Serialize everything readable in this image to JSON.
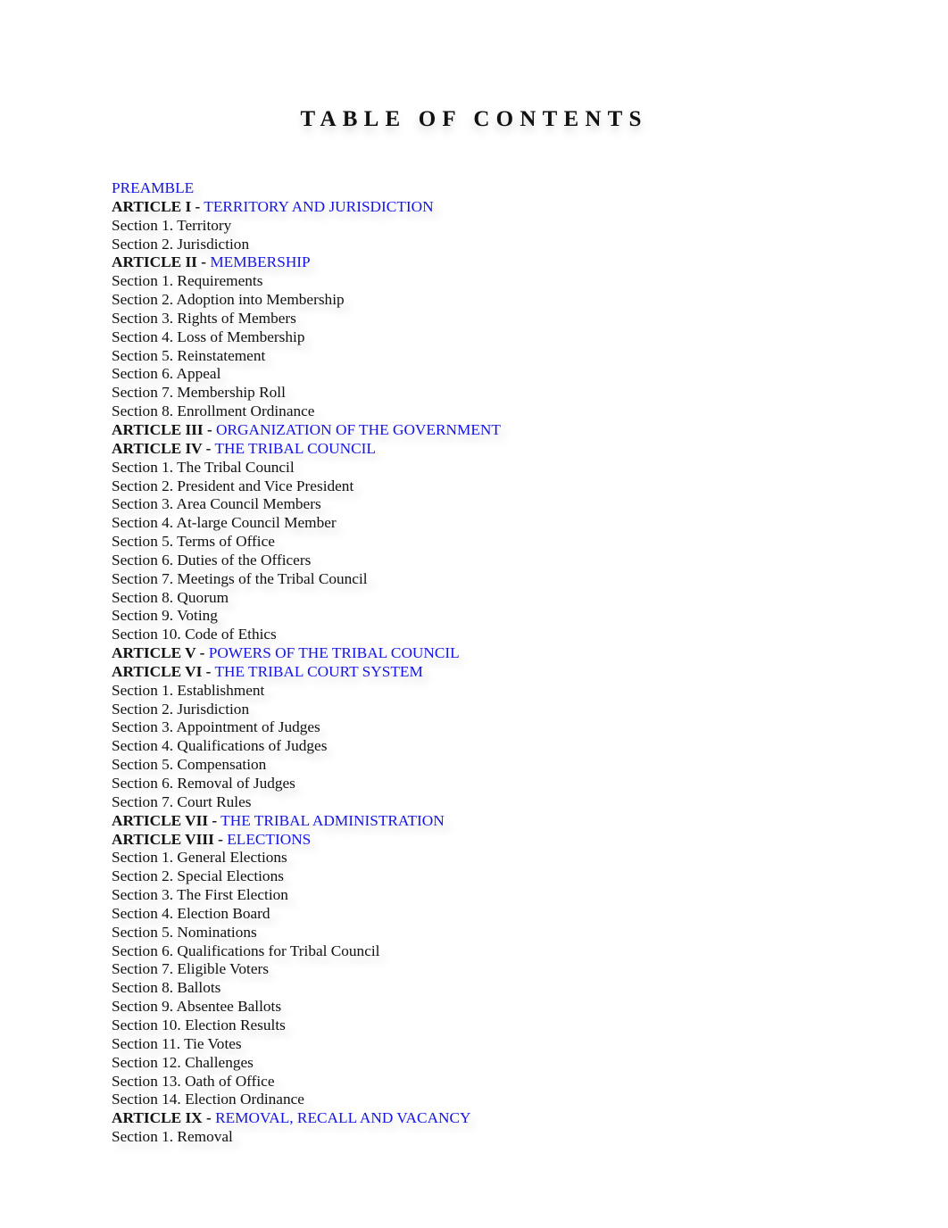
{
  "page": {
    "title": "TABLE OF CONTENTS",
    "link_color": "#1414e6"
  },
  "toc": [
    {
      "type": "link",
      "text": "PREAMBLE"
    },
    {
      "type": "article",
      "label": "ARTICLE I -",
      "title": "TERRITORY AND JURISDICTION"
    },
    {
      "type": "section",
      "text": "Section 1. Territory"
    },
    {
      "type": "section",
      "text": "Section 2. Jurisdiction"
    },
    {
      "type": "article",
      "label": "ARTICLE II -",
      "title": "MEMBERSHIP"
    },
    {
      "type": "section",
      "text": "Section 1. Requirements"
    },
    {
      "type": "section",
      "text": "Section 2. Adoption into Membership"
    },
    {
      "type": "section",
      "text": "Section 3. Rights of Members"
    },
    {
      "type": "section",
      "text": "Section 4. Loss of Membership"
    },
    {
      "type": "section",
      "text": "Section 5. Reinstatement"
    },
    {
      "type": "section",
      "text": "Section 6. Appeal"
    },
    {
      "type": "section",
      "text": "Section 7. Membership Roll"
    },
    {
      "type": "section",
      "text": "Section 8. Enrollment Ordinance"
    },
    {
      "type": "article",
      "label": "ARTICLE III -",
      "title": "ORGANIZATION OF THE GOVERNMENT"
    },
    {
      "type": "article",
      "label": "ARTICLE IV -",
      "title": "THE TRIBAL COUNCIL"
    },
    {
      "type": "section",
      "text": "Section 1. The Tribal Council"
    },
    {
      "type": "section",
      "text": "Section 2. President and Vice President"
    },
    {
      "type": "section",
      "text": "Section 3. Area Council Members"
    },
    {
      "type": "section",
      "text": "Section 4. At-large Council Member"
    },
    {
      "type": "section",
      "text": "Section 5. Terms of Office"
    },
    {
      "type": "section",
      "text": "Section 6. Duties of the Officers"
    },
    {
      "type": "section",
      "text": "Section 7. Meetings of the Tribal Council"
    },
    {
      "type": "section",
      "text": "Section 8. Quorum"
    },
    {
      "type": "section",
      "text": "Section 9. Voting"
    },
    {
      "type": "section",
      "text": "Section 10. Code of Ethics"
    },
    {
      "type": "article",
      "label": "ARTICLE V -",
      "title": "POWERS OF THE TRIBAL COUNCIL"
    },
    {
      "type": "article",
      "label": "ARTICLE VI -",
      "title": "THE TRIBAL COURT SYSTEM"
    },
    {
      "type": "section",
      "text": "Section 1. Establishment"
    },
    {
      "type": "section",
      "text": "Section 2. Jurisdiction"
    },
    {
      "type": "section",
      "text": "Section 3. Appointment of Judges"
    },
    {
      "type": "section",
      "text": "Section 4. Qualifications of Judges"
    },
    {
      "type": "section",
      "text": "Section 5. Compensation"
    },
    {
      "type": "section",
      "text": "Section 6. Removal of Judges"
    },
    {
      "type": "section",
      "text": "Section 7. Court Rules"
    },
    {
      "type": "article",
      "label": "ARTICLE VII -",
      "title": "THE TRIBAL ADMINISTRATION"
    },
    {
      "type": "article",
      "label": "ARTICLE VIII -",
      "title": "ELECTIONS"
    },
    {
      "type": "section",
      "text": "Section 1. General Elections"
    },
    {
      "type": "section",
      "text": "Section 2. Special Elections"
    },
    {
      "type": "section",
      "text": "Section 3. The First Election"
    },
    {
      "type": "section",
      "text": "Section 4. Election Board"
    },
    {
      "type": "section",
      "text": "Section 5. Nominations"
    },
    {
      "type": "section",
      "text": "Section 6. Qualifications for Tribal Council"
    },
    {
      "type": "section",
      "text": "Section 7. Eligible Voters"
    },
    {
      "type": "section",
      "text": "Section 8. Ballots"
    },
    {
      "type": "section",
      "text": "Section 9. Absentee Ballots"
    },
    {
      "type": "section",
      "text": "Section 10. Election Results"
    },
    {
      "type": "section",
      "text": "Section 11. Tie Votes"
    },
    {
      "type": "section",
      "text": "Section 12. Challenges"
    },
    {
      "type": "section",
      "text": "Section 13. Oath of Office"
    },
    {
      "type": "section",
      "text": "Section 14. Election Ordinance"
    },
    {
      "type": "article",
      "label": "ARTICLE IX -",
      "title": "REMOVAL, RECALL AND VACANCY"
    },
    {
      "type": "section",
      "text": "Section 1. Removal"
    }
  ]
}
